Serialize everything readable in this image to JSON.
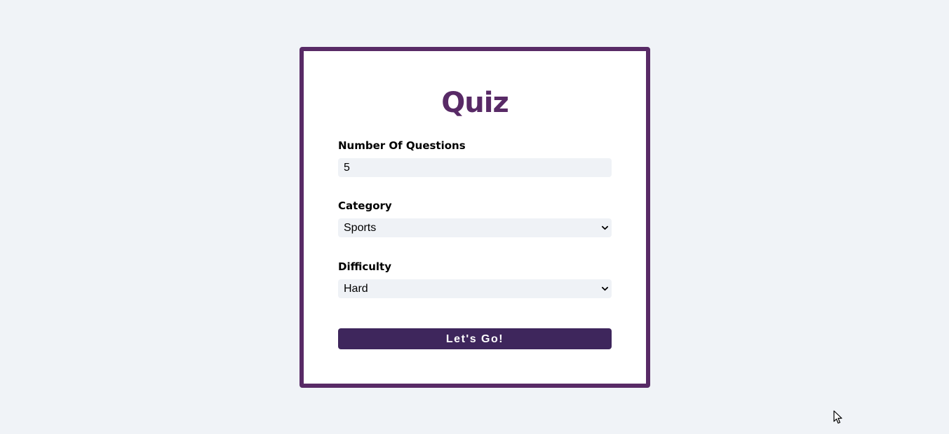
{
  "app": {
    "title": "Quiz"
  },
  "form": {
    "questions": {
      "label": "Number Of Questions",
      "value": "5"
    },
    "category": {
      "label": "Category",
      "selected": "Sports"
    },
    "difficulty": {
      "label": "Difficulty",
      "selected": "Hard"
    },
    "submit_label": "Let's Go!"
  },
  "colors": {
    "page_background": "#f0f3f7",
    "card_border": "#582a66",
    "title": "#582a66",
    "input_background": "#eff2f6",
    "button_background": "#3e265c",
    "button_text": "#ffffff"
  },
  "icons": {
    "select_arrow": "chevron-down-icon",
    "pointer": "mouse-cursor-icon"
  }
}
